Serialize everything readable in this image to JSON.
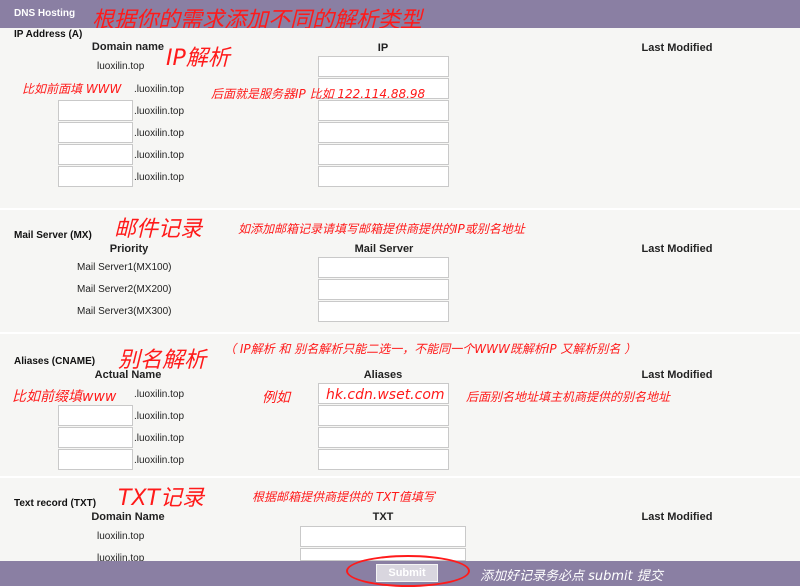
{
  "header": {
    "title": "DNS Hosting"
  },
  "a_record": {
    "section_title": "IP Address (A)",
    "col_domain": "Domain name",
    "col_ip": "IP",
    "col_modified": "Last Modified",
    "root_domain": "luoxilin.top",
    "suffix": ".luoxilin.top"
  },
  "mx_record": {
    "section_title": "Mail Server (MX)",
    "col_priority": "Priority",
    "col_server": "Mail Server",
    "col_modified": "Last Modified",
    "rows": [
      "Mail Server1(MX100)",
      "Mail Server2(MX200)",
      "Mail Server3(MX300)"
    ]
  },
  "cname_record": {
    "section_title": "Aliases (CNAME)",
    "col_actual": "Actual Name",
    "col_aliases": "Aliases",
    "col_modified": "Last Modified",
    "suffix": ".luoxilin.top"
  },
  "txt_record": {
    "section_title": "Text record (TXT)",
    "col_domain": "Domain Name",
    "col_txt": "TXT",
    "col_modified": "Last Modified",
    "rows": [
      "luoxilin.top",
      "luoxilin.top"
    ]
  },
  "footer": {
    "submit_label": "Submit"
  },
  "annotations": {
    "top": "根据你的需求添加不同的解析类型",
    "ip": "IP解析",
    "ip_prefix": "比如前面填 WWW",
    "ip_value": "后面就是服务器IP  比如   122.114.88.98",
    "mail": "邮件记录",
    "mail_note": "如添加邮箱记录请填写邮箱提供商提供的IP或别名地址",
    "alias": "别名解析",
    "alias_note": "（ IP解析 和 别名解析只能二选一，不能同一个WWW既解析IP 又解析别名 ）",
    "alias_prefix": "比如前缀填www",
    "alias_example": "例如",
    "alias_value": "hk.cdn.wset.com",
    "alias_host": "后面别名地址填主机商提供的别名地址",
    "txt": "TXT记录",
    "txt_note": "根据邮箱提供商提供的 TXT值填写",
    "submit_note": "添加好记录务必点 submit 提交"
  },
  "colors": {
    "header_bar": "#8a7fa3",
    "annotation": "#ff1a1a",
    "section_bg": "#f6f6f4"
  }
}
